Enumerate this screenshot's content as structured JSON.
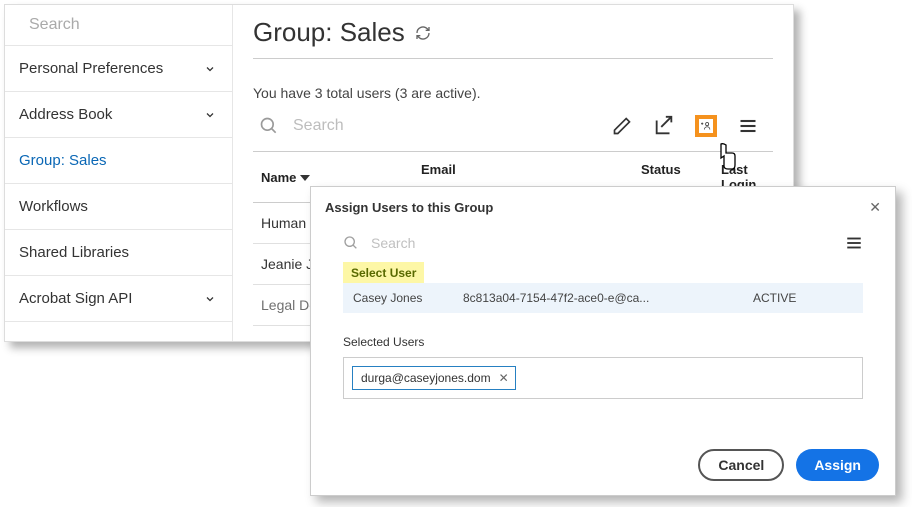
{
  "sidebar": {
    "searchPlaceholder": "Search",
    "items": [
      {
        "label": "Personal Preferences",
        "expandable": true
      },
      {
        "label": "Address Book",
        "expandable": true
      },
      {
        "label": "Group: Sales",
        "active": true
      },
      {
        "label": "Workflows"
      },
      {
        "label": "Shared Libraries"
      },
      {
        "label": "Acrobat Sign API",
        "expandable": true
      }
    ]
  },
  "page": {
    "title": "Group: Sales",
    "subline": "You have 3 total users (3 are active).",
    "toolbarSearchPlaceholder": "Search",
    "columns": {
      "name": "Name",
      "email": "Email",
      "status": "Status",
      "lastLogin": "Last Login"
    },
    "rows": [
      "Human Re",
      "Jeanie Jon",
      "Legal Dep"
    ]
  },
  "modal": {
    "title": "Assign Users to this Group",
    "searchPlaceholder": "Search",
    "selectHeader": "Select User",
    "candidate": {
      "name": "Casey Jones",
      "email": "8c813a04-7154-47f2-ace0-e@ca...",
      "status": "ACTIVE"
    },
    "selectedLabel": "Selected Users",
    "chip": "durga@caseyjones.dom",
    "cancel": "Cancel",
    "assign": "Assign"
  }
}
